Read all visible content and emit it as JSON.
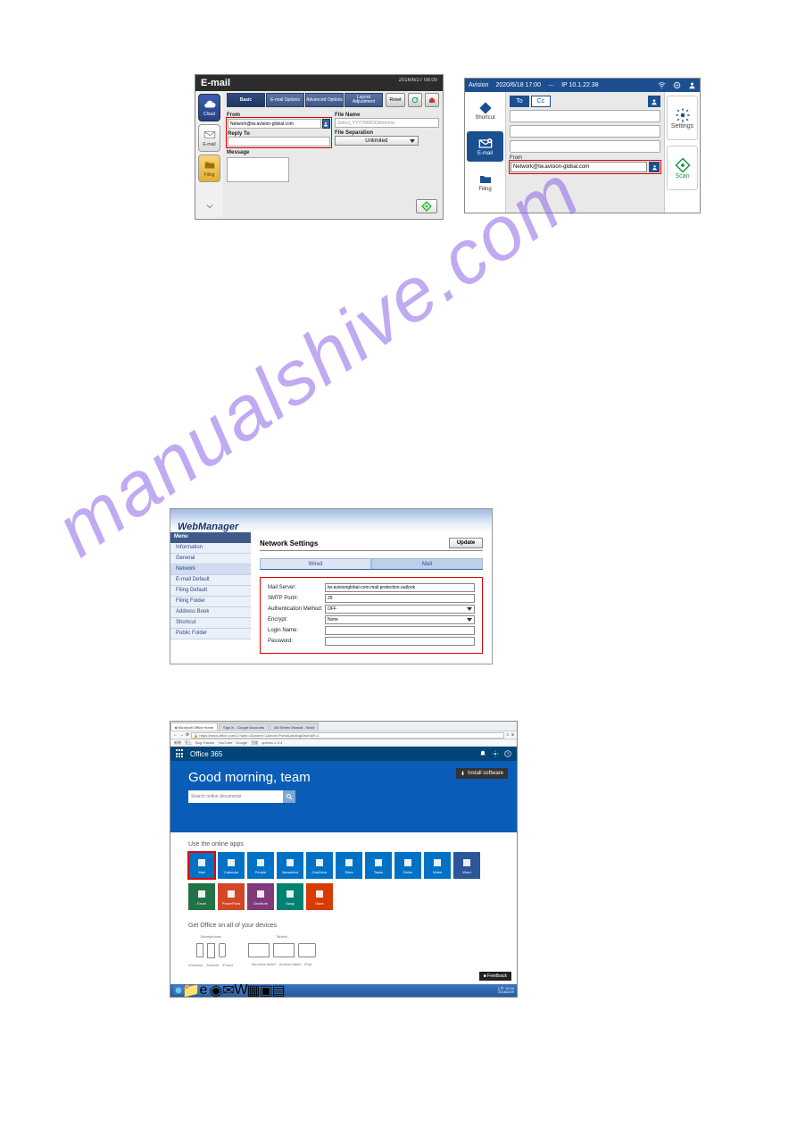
{
  "watermark": "manualshive.com",
  "panelA": {
    "title": "E-mail",
    "timestamp": "2016/6/27 08:00",
    "sidebar": [
      {
        "label": "Cloud",
        "kind": "cloud"
      },
      {
        "label": "E-mail",
        "kind": "mail"
      },
      {
        "label": "Filing",
        "kind": "filing"
      }
    ],
    "tabs": [
      "Basic",
      "E-mail Options",
      "Advanced Options",
      "Layout Adjustment"
    ],
    "labels": {
      "from": "From",
      "replyto": "Reply To",
      "message": "Message",
      "filename": "File Name",
      "filesep": "File Separation"
    },
    "from_value": "Network@tw.avision-global.com",
    "filename_value": "Select_YYYYMMDDhhmmss",
    "filesep_value": "Unlimited",
    "reset": "Reset"
  },
  "panelB": {
    "brand": "Avision",
    "datetime": "2020/6/18 17:00",
    "ip": "IP 10.1.22.38",
    "left": [
      {
        "label": "Shortcut"
      },
      {
        "label": "E-mail"
      },
      {
        "label": "Filing"
      }
    ],
    "tabs": {
      "to": "To",
      "cc": "Cc"
    },
    "from_label": "From",
    "from_value": "Network@tw.avision-global.com",
    "right": [
      {
        "label": "Settings"
      },
      {
        "label": "Scan"
      }
    ]
  },
  "panelC": {
    "brand": "WebManager",
    "menu_header": "Menu",
    "menu": [
      "Information",
      "General",
      "Network",
      "E-mail Default",
      "Filing Default",
      "Filing Folder",
      "Address Book",
      "Shortcut",
      "Public Folder"
    ],
    "section_title": "Network Settings",
    "update": "Update",
    "tabs": [
      "Wired",
      "Mail"
    ],
    "rows": [
      {
        "label": "Mail Server:",
        "value": "tw-avisionglobal-com.mail.protection.outlook"
      },
      {
        "label": "SMTP Port#:",
        "value": "25"
      },
      {
        "label": "Authentication Method:",
        "value": "OFF",
        "select": true
      },
      {
        "label": "Encrypt:",
        "value": "None",
        "select": true
      },
      {
        "label": "Login Name:",
        "value": ""
      },
      {
        "label": "Password:",
        "value": ""
      }
    ]
  },
  "panelD": {
    "browser_tabs": [
      "Microsoft Office Home",
      "Sign in - Google Accounts",
      "AN Series Manual - Word"
    ],
    "url": "https://www.office.com/1/?auth=2&home=1&from=PortalLanding&fromAR=1",
    "bookmarks": [
      "新增",
      "売上",
      "Bug Tracker",
      "YouTube",
      "Google",
      "百度",
      "opencc-1.0.4"
    ],
    "brand": "Office 365",
    "install": "Install software",
    "greeting": "Good morning, team",
    "search_placeholder": "Search online documents",
    "section_online": "Use the online apps",
    "apps_row1": [
      {
        "name": "Mail",
        "color": "#0072c6"
      },
      {
        "name": "Calendar",
        "color": "#0072c6"
      },
      {
        "name": "People",
        "color": "#0072c6"
      },
      {
        "name": "Newsfeed",
        "color": "#0072c6"
      },
      {
        "name": "OneDrive",
        "color": "#0072c6"
      },
      {
        "name": "Sites",
        "color": "#0072c6"
      },
      {
        "name": "Tasks",
        "color": "#0072c6"
      },
      {
        "name": "Delve",
        "color": "#0072c6"
      },
      {
        "name": "Video",
        "color": "#0072c6"
      },
      {
        "name": "Word",
        "color": "#2b579a"
      }
    ],
    "apps_row2": [
      {
        "name": "Excel",
        "color": "#217346"
      },
      {
        "name": "PowerPoint",
        "color": "#d24726"
      },
      {
        "name": "OneNote",
        "color": "#80397b"
      },
      {
        "name": "Sway",
        "color": "#008272"
      },
      {
        "name": "Store",
        "color": "#d83b01"
      }
    ],
    "section_devices": "Get Office on all of your devices",
    "device_groups": [
      {
        "heading": "Smartphones",
        "items": [
          "Windows",
          "Android",
          "iPhone"
        ]
      },
      {
        "heading": "Tablets",
        "items": [
          "Windows tablet",
          "Android tablet",
          "iPad"
        ]
      }
    ],
    "feedback": "Feedback",
    "clock": {
      "time": "上午 10:14",
      "date": "2016/6/29"
    }
  }
}
